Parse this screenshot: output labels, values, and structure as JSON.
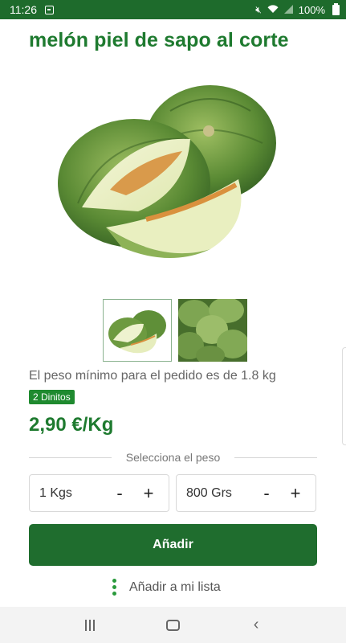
{
  "status_bar": {
    "time": "11:26",
    "battery": "100%",
    "icons": [
      "app-notification-icon",
      "mute-icon",
      "wifi-icon",
      "signal-icon",
      "battery-icon"
    ]
  },
  "product": {
    "title": "melón piel de sapo al corte",
    "image": "melon-image",
    "thumbnails": [
      "melon-cut-thumbnail",
      "melons-pile-thumbnail"
    ],
    "min_weight_text": "El peso mínimo para el pedido es de 1.8 kg",
    "badge": "2 Dinitos",
    "price": "2,90 €/Kg"
  },
  "weight_selector": {
    "label": "Selecciona el peso",
    "kg": {
      "value": "1 Kgs",
      "minus": "-",
      "plus": "+"
    },
    "grs": {
      "value": "800 Grs",
      "minus": "-",
      "plus": "+"
    }
  },
  "actions": {
    "add": "Añadir",
    "add_to_list": "Añadir a mi lista"
  },
  "colors": {
    "brand_green": "#1e7a2f",
    "button_green": "#1f6d2e",
    "status_bar": "#1e6b2c"
  }
}
